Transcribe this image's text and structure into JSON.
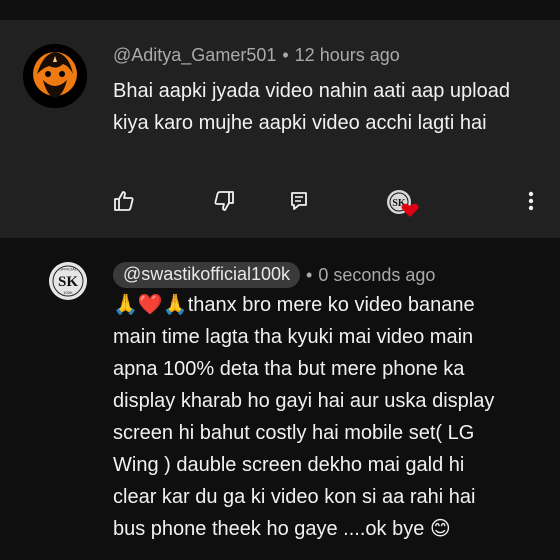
{
  "comments": [
    {
      "author": "@Aditya_Gamer501",
      "separator": "•",
      "time": "12 hours ago",
      "text": "Bhai aapki jyada video nahin aati aap upload kiya karo mujhe aapki video acchi lagti hai",
      "actions": {
        "like_icon": "thumb-up-icon",
        "dislike_icon": "thumb-down-icon",
        "reply_icon": "reply-icon",
        "creator_heart": "creator-heart-icon",
        "more_icon": "more-vertical-icon"
      }
    },
    {
      "author": "@swastikofficial100k",
      "separator": "•",
      "time": "0 seconds ago",
      "avatar_text": {
        "top": "OFFICIAL",
        "mark": "SK",
        "bottom": "100K"
      },
      "text_lines": [
        "🙏❤️🙏thanx bro mere ko video banane",
        "main time lagta tha kyuki mai video main",
        "apna 100% deta tha but mere phone ka",
        "display kharab ho gayi hai aur uska display",
        "screen hi bahut costly hai mobile set( LG",
        "Wing ) dauble screen dekho mai gald hi",
        "clear kar du ga ki video kon si aa rahi hai",
        "bus phone theek ho gaye ....ok bye 😊"
      ]
    }
  ],
  "colors": {
    "background": "#0f0f0f",
    "highlighted_comment": "#212121",
    "meta_text": "#aaaaaa",
    "body_text": "#f1f1f1",
    "author_chip": "#3a3a3a",
    "heart": "#e00012"
  }
}
